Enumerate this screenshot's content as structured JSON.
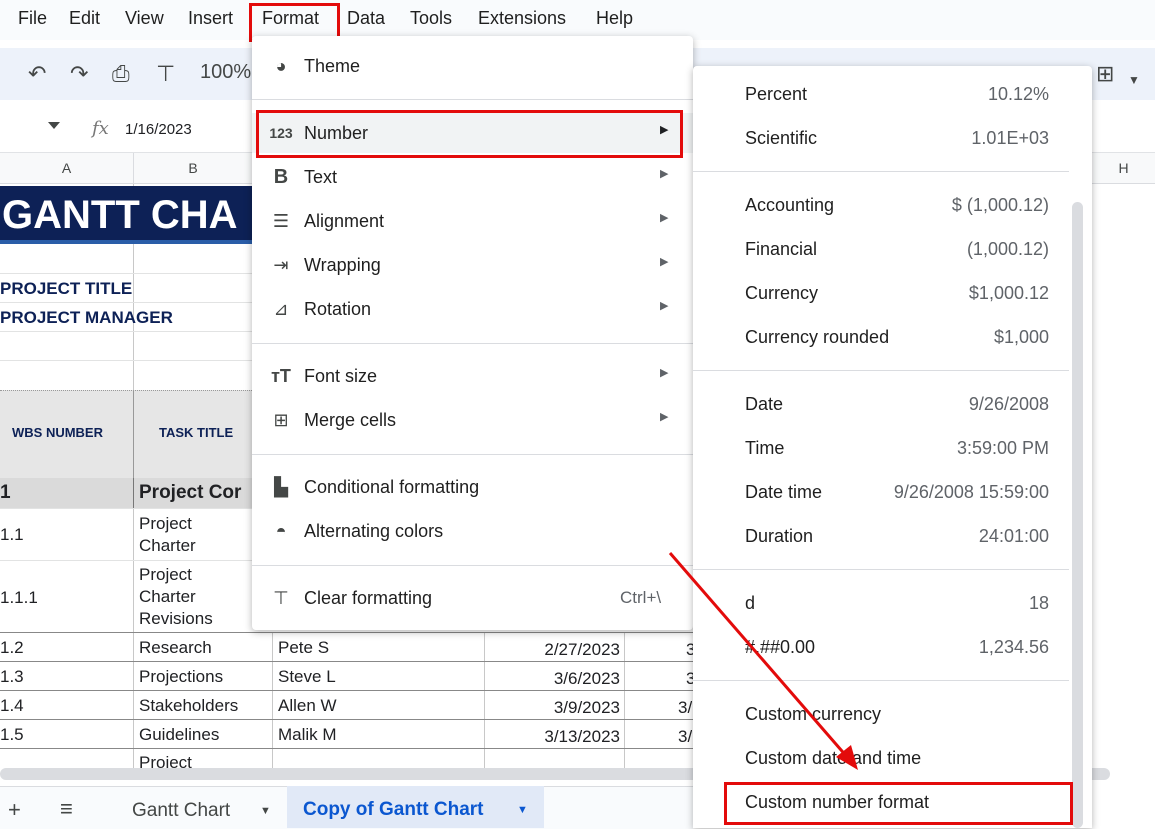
{
  "menubar": {
    "items": [
      "File",
      "Edit",
      "View",
      "Insert",
      "Format",
      "Data",
      "Tools",
      "Extensions",
      "Help"
    ]
  },
  "toolbar": {
    "zoom": "100%",
    "icons": [
      "undo-icon",
      "redo-icon",
      "print-icon",
      "paint-format-icon"
    ]
  },
  "formula_bar": {
    "fx": "fx",
    "value": "1/16/2023"
  },
  "columns": [
    "A",
    "B",
    "H"
  ],
  "sheet": {
    "title": "GANTT CHA",
    "project_title_label": "PROJECT TITLE",
    "project_manager_label": "PROJECT MANAGER",
    "headers": {
      "wbs": "WBS NUMBER",
      "task": "TASK TITLE"
    },
    "section_row": {
      "wbs": "1",
      "task": "Project Cor"
    },
    "rows": [
      {
        "wbs": "1.1",
        "task_line1": "Project",
        "task_line2": "Charter",
        "task_line3": "",
        "owner": "",
        "date": ""
      },
      {
        "wbs": "1.1.1",
        "task_line1": "Project",
        "task_line2": "Charter",
        "task_line3": "Revisions",
        "owner": "",
        "date": ""
      },
      {
        "wbs": "1.2",
        "task_line1": "Research",
        "task_line2": "",
        "task_line3": "",
        "owner": "Pete S",
        "date": "2/27/2023",
        "next": "3"
      },
      {
        "wbs": "1.3",
        "task_line1": "Projections",
        "task_line2": "",
        "task_line3": "",
        "owner": "Steve L",
        "date": "3/6/2023",
        "next": "3"
      },
      {
        "wbs": "1.4",
        "task_line1": "Stakeholders",
        "task_line2": "",
        "task_line3": "",
        "owner": "Allen W",
        "date": "3/9/2023",
        "next": "3/"
      },
      {
        "wbs": "1.5",
        "task_line1": "Guidelines",
        "task_line2": "",
        "task_line3": "",
        "owner": "Malik M",
        "date": "3/13/2023",
        "next": "3/"
      },
      {
        "wbs": "",
        "task_line1": "Project",
        "task_line2": "",
        "task_line3": "",
        "owner": "",
        "date": ""
      }
    ]
  },
  "format_menu": {
    "items": [
      {
        "label": "Theme",
        "icon": "palette-icon",
        "submenu": false
      },
      {
        "label": "Number",
        "icon": "123-icon",
        "submenu": true
      },
      {
        "label": "Text",
        "icon": "bold-icon",
        "submenu": true
      },
      {
        "label": "Alignment",
        "icon": "align-icon",
        "submenu": true
      },
      {
        "label": "Wrapping",
        "icon": "wrap-icon",
        "submenu": true
      },
      {
        "label": "Rotation",
        "icon": "rotation-icon",
        "submenu": true
      },
      {
        "label": "Font size",
        "icon": "font-size-icon",
        "submenu": true
      },
      {
        "label": "Merge cells",
        "icon": "merge-icon",
        "submenu": true
      },
      {
        "label": "Conditional formatting",
        "icon": "conditional-format-icon",
        "submenu": false
      },
      {
        "label": "Alternating colors",
        "icon": "drop-icon",
        "submenu": false
      },
      {
        "label": "Clear formatting",
        "icon": "clear-format-icon",
        "submenu": false,
        "shortcut": "Ctrl+\\"
      }
    ]
  },
  "number_menu": {
    "items": [
      {
        "label": "Percent",
        "value": "10.12%"
      },
      {
        "label": "Scientific",
        "value": "1.01E+03"
      },
      {
        "label": "Accounting",
        "value": "$ (1,000.12)"
      },
      {
        "label": "Financial",
        "value": "(1,000.12)"
      },
      {
        "label": "Currency",
        "value": "$1,000.12"
      },
      {
        "label": "Currency rounded",
        "value": "$1,000"
      },
      {
        "label": "Date",
        "value": "9/26/2008"
      },
      {
        "label": "Time",
        "value": "3:59:00 PM"
      },
      {
        "label": "Date time",
        "value": "9/26/2008 15:59:00"
      },
      {
        "label": "Duration",
        "value": "24:01:00"
      },
      {
        "label": "d",
        "value": "18"
      },
      {
        "label": "#,##0.00",
        "value": "1,234.56"
      },
      {
        "label": "Custom currency",
        "value": ""
      },
      {
        "label": "Custom date and time",
        "value": ""
      },
      {
        "label": "Custom number format",
        "value": ""
      }
    ]
  },
  "sheet_tabs": {
    "tabs": [
      "Gantt Chart",
      "Copy of Gantt Chart"
    ],
    "active": "Copy of Gantt Chart"
  },
  "colors": {
    "highlight_red": "#e30b0b",
    "navy": "#0d2156",
    "active_tab": "#0b57d0"
  }
}
